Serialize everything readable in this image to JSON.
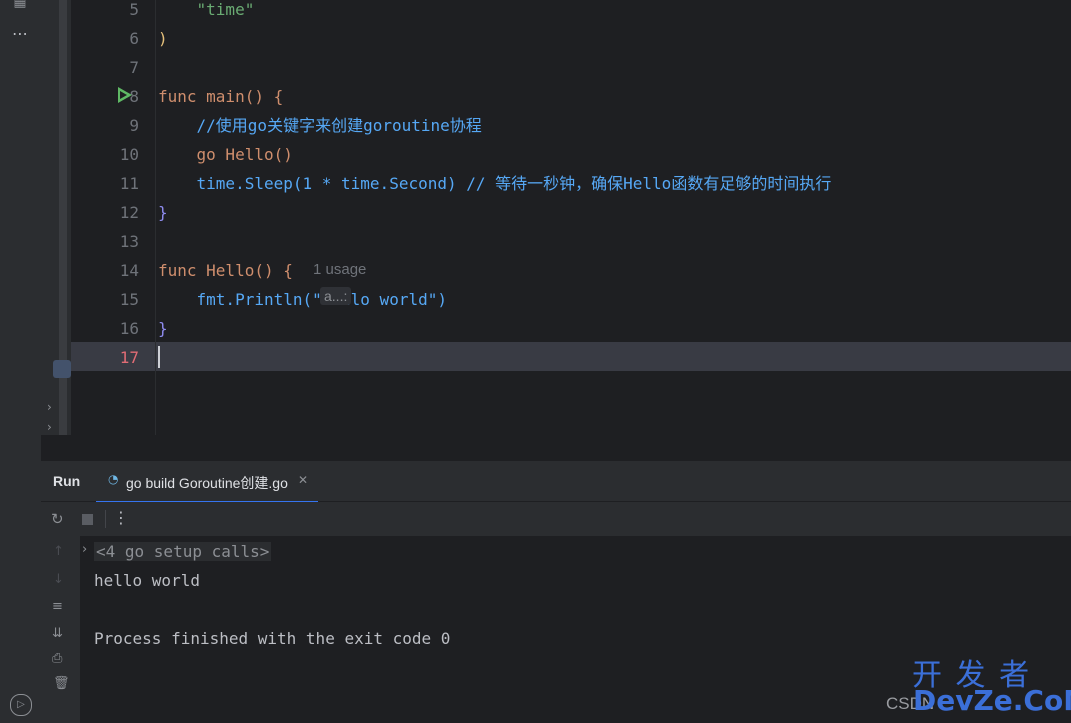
{
  "editor": {
    "lines": [
      {
        "num": "5",
        "code": "    \"time\""
      },
      {
        "num": "6",
        "code": ")"
      },
      {
        "num": "7",
        "code": ""
      },
      {
        "num": "8",
        "code": "func main() {"
      },
      {
        "num": "9",
        "code": "    //使用go关键字来创建goroutine协程"
      },
      {
        "num": "10",
        "code": "    go Hello()"
      },
      {
        "num": "11",
        "code": "    time.Sleep(1 * time.Second) // 等待一秒钟，确保Hello函数有足够的时间执行"
      },
      {
        "num": "12",
        "code": "}"
      },
      {
        "num": "13",
        "code": ""
      },
      {
        "num": "14",
        "code": "func Hello() {"
      },
      {
        "num": "15",
        "code": "    fmt.Println(\"hello world\")"
      },
      {
        "num": "16",
        "code": "}"
      },
      {
        "num": "17",
        "code": ""
      }
    ],
    "usage_hint": "1 usage",
    "param_hint": "a...:"
  },
  "panel": {
    "title": "Run",
    "tab_label": "go build Goroutine创建.go"
  },
  "console": {
    "setup": "<4 go setup calls>",
    "output": "hello world",
    "finished": "Process finished with the exit code 0"
  },
  "watermark": {
    "top": "开 发 者",
    "bottom": "DevZe.CoM",
    "prefix": "CSDN"
  },
  "colors": {
    "keyword": "#cf8e6d",
    "function": "#56a8f5",
    "string": "#6aab73",
    "comment": "#7a7e85",
    "background": "#1e1f22",
    "current_line_number": "#e06c75"
  }
}
